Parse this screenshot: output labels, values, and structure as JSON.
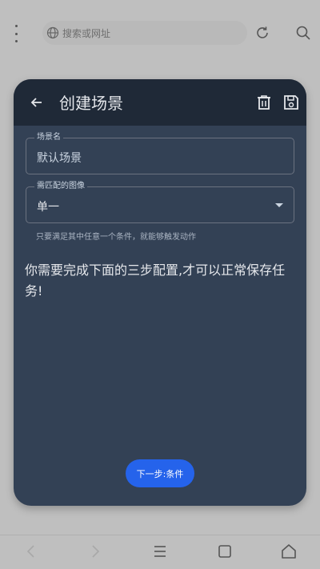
{
  "browser": {
    "url_placeholder": "搜索或网址",
    "icons": {
      "menu": "more-vertical-icon",
      "globe": "globe-icon",
      "refresh": "refresh-icon",
      "search": "search-icon"
    }
  },
  "dialog": {
    "title": "创建场景",
    "scene_name": {
      "label": "场景名",
      "value": "默认场景"
    },
    "match_image": {
      "label": "需匹配的图像",
      "value": "单一"
    },
    "helper_text": "只要满足其中任意一个条件，就能够触发动作",
    "instruction": "你需要完成下面的三步配置,才可以正常保存任务!",
    "next_button": "下一步:条件"
  },
  "colors": {
    "card": "#334155",
    "header": "#1f2937",
    "accent": "#2563eb"
  }
}
